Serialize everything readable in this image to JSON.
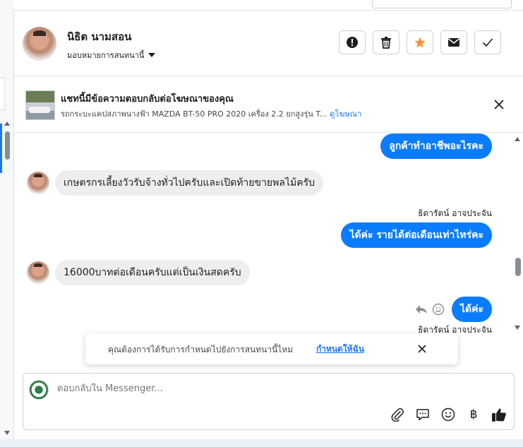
{
  "header": {
    "contact_name": "นิธิต นามสอน",
    "assign_label": "มอบหมายการสนทนานี้"
  },
  "ad": {
    "title": "แชทนี้มีข้อความตอบกลับต่อโฆษณาของคุณ",
    "subtitle": "รถกระบะแคปสภาพนางฟ้า MAZDA BT-50 PRO 2020 เครื่อง 2.2 ยกสูงรุ่น T...",
    "link": "ดูโฆษณา"
  },
  "messages": [
    {
      "direction": "out",
      "text": "ลูกค้าทำอาชีพอะไรคะ"
    },
    {
      "direction": "in",
      "text": "เกษตรกรเลี้ยงวัวรับจ้างทั่วไปครับและเปิดท้ายขายพลไม้ครับ"
    },
    {
      "direction": "out",
      "sender": "ธิดารัตน์ อาจประจัน",
      "text": "ได้ค่ะ รายได้ต่อเดือนเท่าไหร่คะ"
    },
    {
      "direction": "in",
      "text": "16000บาทต่อเดือนครับแต่เป็นเงินสดครับ"
    },
    {
      "direction": "out",
      "sender": "ธิดารัตน์ อาจประจัน",
      "text": "ได้ค่ะ"
    }
  ],
  "toast": {
    "text": "คุณต้องการได้รับการกำหนดไปยังการสนทนานี้ไหม",
    "link": "กำหนดให้ฉัน"
  },
  "composer": {
    "placeholder": "ตอบกลับใน Messenger..."
  },
  "colors": {
    "accent": "#1877f2",
    "outgoing_bubble": "#0a7cff",
    "incoming_bubble": "#eeeeee",
    "star": "#f7923b"
  },
  "icons": {
    "header_actions": [
      "exclamation-icon",
      "trash-icon",
      "star-icon",
      "envelope-icon",
      "check-icon"
    ],
    "composer_tools": [
      "paperclip-icon",
      "speech-bubble-icon",
      "smiley-icon",
      "baht-icon",
      "thumbs-up-icon"
    ]
  }
}
